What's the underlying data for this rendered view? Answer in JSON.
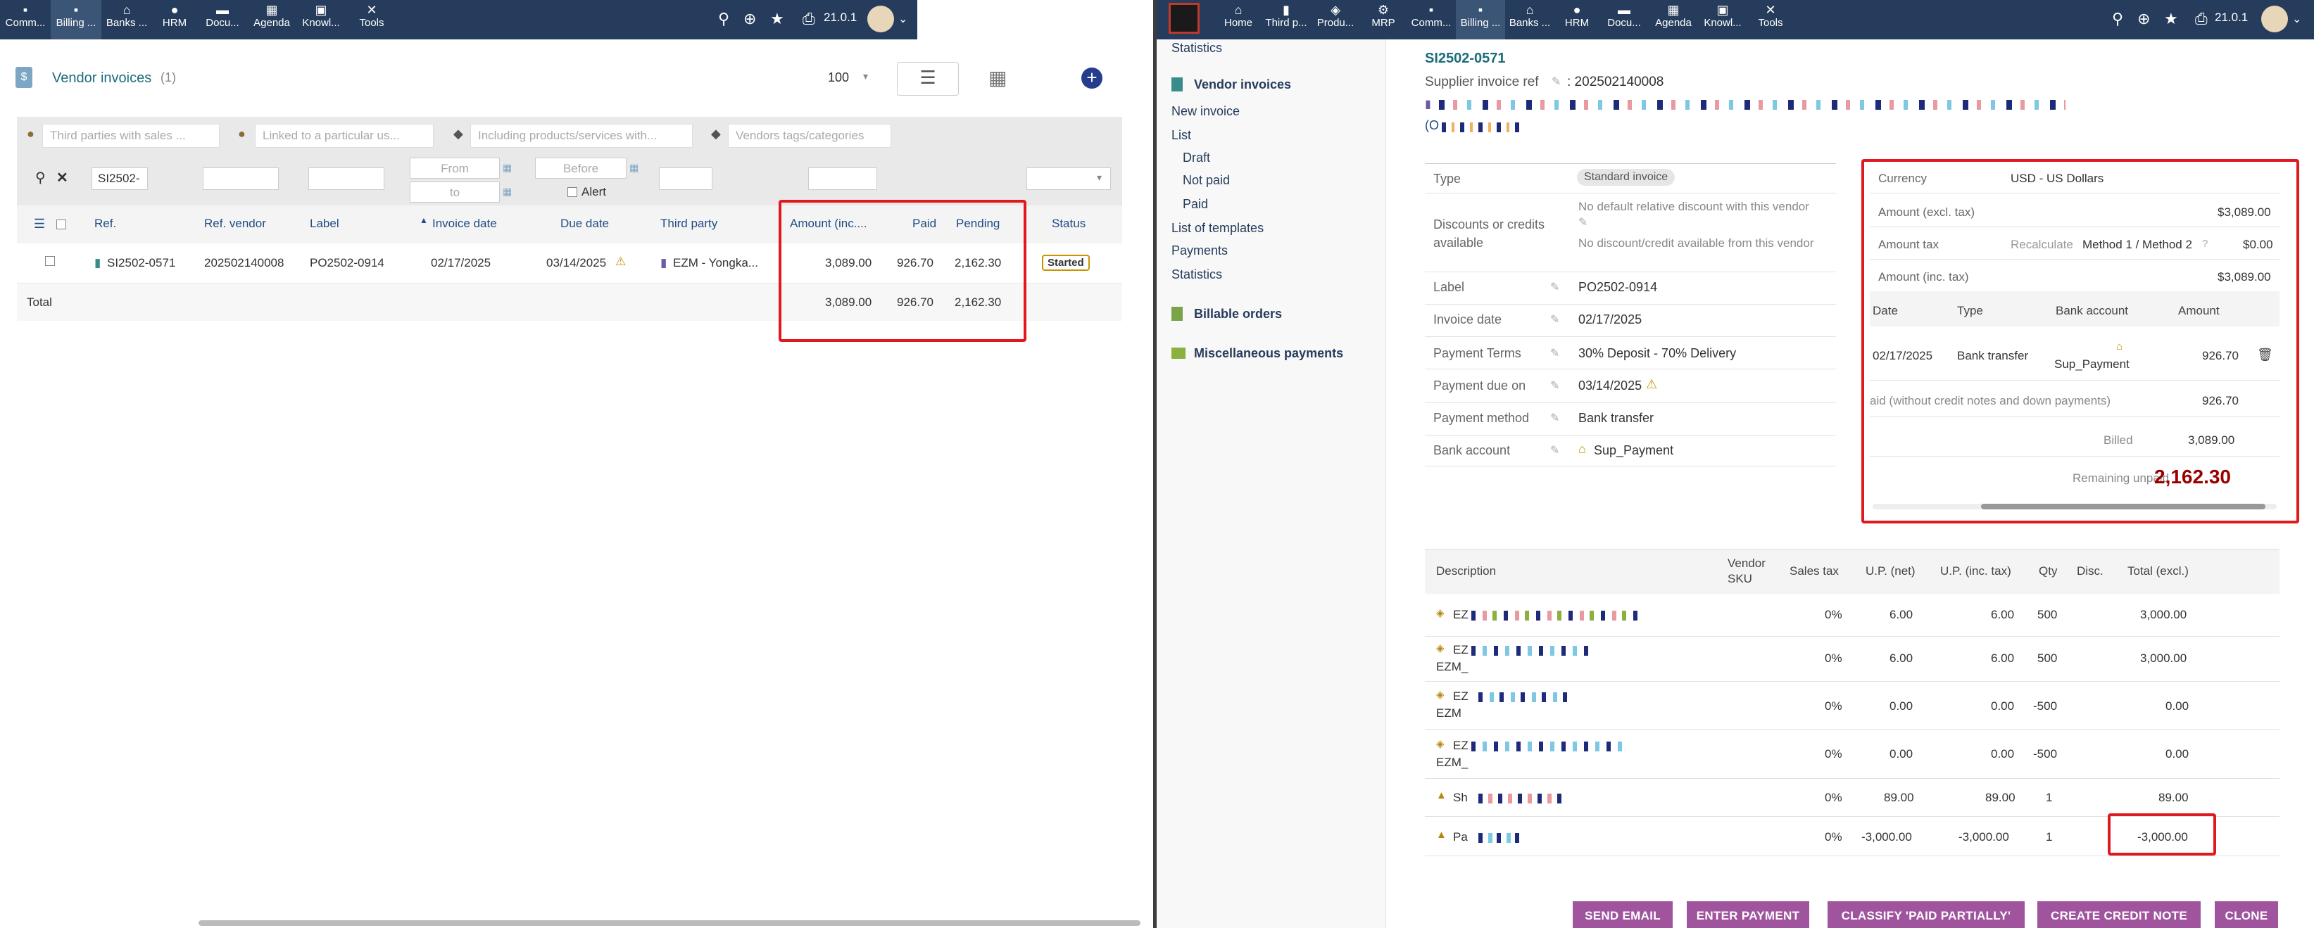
{
  "left": {
    "menu": [
      "Comm...",
      "Billing ...",
      "Banks ...",
      "HRM",
      "Docu...",
      "Agenda",
      "Knowl...",
      "Tools"
    ],
    "version": "21.0.1",
    "title": "Vendor invoices",
    "count": "(1)",
    "page_size": "100",
    "filters": {
      "third_parties": "Third parties with sales ...",
      "linked_user": "Linked to a particular us...",
      "products": "Including products/services with...",
      "vendor_tags": "Vendors tags/categories",
      "search_ref": "SI2502-",
      "from": "From",
      "to": "to",
      "before": "Before",
      "alert": "Alert"
    },
    "columns": [
      "Ref.",
      "Ref. vendor",
      "Label",
      "Invoice date",
      "Due date",
      "Third party",
      "Amount (inc....",
      "Paid",
      "Pending",
      "Status"
    ],
    "row": {
      "ref": "SI2502-0571",
      "ref_vendor": "202502140008",
      "label": "PO2502-0914",
      "invoice_date": "02/17/2025",
      "due_date": "03/14/2025",
      "third_party": "EZM - Yongka...",
      "amount": "3,089.00",
      "paid": "926.70",
      "pending": "2,162.30",
      "status": "Started"
    },
    "total": {
      "label": "Total",
      "amount": "3,089.00",
      "paid": "926.70",
      "pending": "2,162.30"
    }
  },
  "right": {
    "menu": [
      "Home",
      "Third p...",
      "Produ...",
      "MRP",
      "Comm...",
      "Billing ...",
      "Banks ...",
      "HRM",
      "Docu...",
      "Agenda",
      "Knowl...",
      "Tools"
    ],
    "version": "21.0.1",
    "sidebar": {
      "statistics_top": "Statistics",
      "section_vendor": "Vendor invoices",
      "new_invoice": "New invoice",
      "list": "List",
      "draft": "Draft",
      "not_paid": "Not paid",
      "paid": "Paid",
      "list_templates": "List of templates",
      "payments": "Payments",
      "statistics": "Statistics",
      "billable_orders": "Billable orders",
      "misc_payments": "Miscellaneous payments"
    },
    "invoice": {
      "ref": "SI2502-0571",
      "supplier_ref_label": "Supplier invoice ref",
      "supplier_ref": ": 202502140008",
      "line_prefix": "(O",
      "fields": [
        {
          "label": "Type",
          "value": "Standard invoice"
        },
        {
          "label": "Discounts or credits available",
          "value": "No default relative discount with this vendor",
          "value2": "No discount/credit available from this vendor"
        },
        {
          "label": "Label",
          "value": "PO2502-0914"
        },
        {
          "label": "Invoice date",
          "value": "02/17/2025"
        },
        {
          "label": "Payment Terms",
          "value": "30% Deposit - 70% Delivery"
        },
        {
          "label": "Payment due on",
          "value": "03/14/2025"
        },
        {
          "label": "Payment method",
          "value": "Bank transfer"
        },
        {
          "label": "Bank account",
          "value": "Sup_Payment"
        }
      ]
    },
    "summary": {
      "currency_label": "Currency",
      "currency": "USD - US Dollars",
      "excl_label": "Amount (excl. tax)",
      "excl": "$3,089.00",
      "tax_label": "Amount tax",
      "recalc": "Recalculate",
      "method": "Method 1 / Method 2",
      "tax": "$0.00",
      "inc_label": "Amount (inc. tax)",
      "inc": "$3,089.00",
      "pay_cols": [
        "Date",
        "Type",
        "Bank account",
        "Amount"
      ],
      "payment": {
        "date": "02/17/2025",
        "type": "Bank transfer",
        "account": "Sup_Payment",
        "amount": "926.70"
      },
      "paid_label": "aid (without credit notes and down payments)",
      "paid": "926.70",
      "billed_label": "Billed",
      "billed": "3,089.00",
      "remain_label": "Remaining unpaid",
      "remain": "2,162.30"
    },
    "lines": {
      "columns": [
        "Description",
        "Vendor SKU",
        "Sales tax",
        "U.P. (net)",
        "U.P. (inc. tax)",
        "Qty",
        "Disc.",
        "Total (excl.)"
      ],
      "rows": [
        {
          "d1": "EZ",
          "d2": "",
          "tax": "0%",
          "up": "6.00",
          "upi": "6.00",
          "qty": "500",
          "total": "3,000.00"
        },
        {
          "d1": "EZ",
          "d2": "EZM_",
          "tax": "0%",
          "up": "6.00",
          "upi": "6.00",
          "qty": "500",
          "total": "3,000.00"
        },
        {
          "d1": "EZ",
          "d2": "EZM",
          "tax": "0%",
          "up": "0.00",
          "upi": "0.00",
          "qty": "-500",
          "total": "0.00"
        },
        {
          "d1": "EZ",
          "d2": "EZM_",
          "tax": "0%",
          "up": "0.00",
          "upi": "0.00",
          "qty": "-500",
          "total": "0.00"
        },
        {
          "d1": "Sh",
          "d2": "",
          "tax": "0%",
          "up": "89.00",
          "upi": "89.00",
          "qty": "1",
          "total": "89.00"
        },
        {
          "d1": "Pa",
          "d2": "",
          "tax": "0%",
          "up": "-3,000.00",
          "upi": "-3,000.00",
          "qty": "1",
          "total": "-3,000.00"
        }
      ]
    },
    "actions": [
      "SEND EMAIL",
      "ENTER PAYMENT",
      "CLASSIFY 'PAID PARTIALLY'",
      "CREATE CREDIT NOTE",
      "CLONE"
    ]
  },
  "colors": {
    "topbar": "#263c5c",
    "highlight": "#e0191f",
    "button": "#a0549e",
    "remain": "#9a0000"
  }
}
